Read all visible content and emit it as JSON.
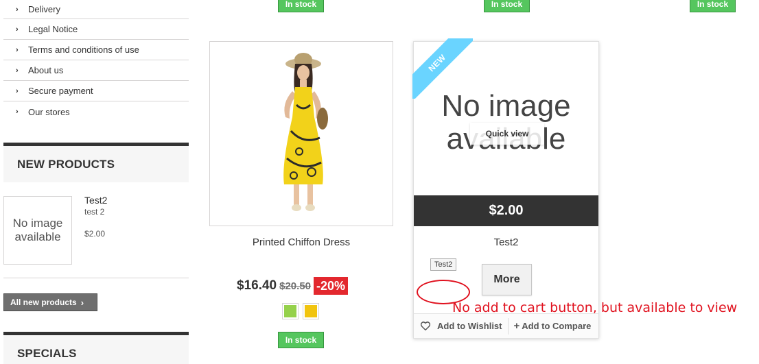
{
  "sidebar": {
    "info_links": [
      "Delivery",
      "Legal Notice",
      "Terms and conditions of use",
      "About us",
      "Secure payment",
      "Our stores"
    ],
    "new_products": {
      "title": "NEW PRODUCTS",
      "item": {
        "thumb_text": "No image available",
        "name": "Test2",
        "desc": "test 2",
        "price": "$2.00"
      },
      "all_button": "All new products"
    },
    "specials_title": "SPECIALS"
  },
  "top_row_stock": [
    "In stock",
    "In stock",
    "In stock"
  ],
  "product1": {
    "name": "Printed Chiffon Dress",
    "price": "$16.40",
    "old_price": "$20.50",
    "discount": "-20%",
    "swatch_colors": [
      "#95d14b",
      "#f1c40f"
    ],
    "stock": "In stock"
  },
  "product2": {
    "badge": "NEW",
    "image_text": "No image available",
    "quick_view": "Quick view",
    "price": "$2.00",
    "name": "Test2",
    "tooltip": "Test2",
    "more_button": "More",
    "wishlist": "Add to Wishlist",
    "compare": "Add to Compare"
  },
  "annotation": "No add to cart button, but available to view"
}
